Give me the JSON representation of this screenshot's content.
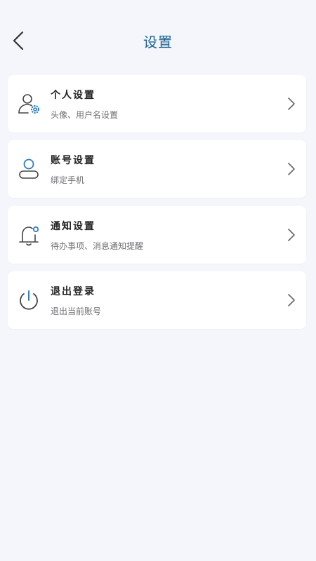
{
  "header": {
    "title": "设置",
    "back_icon": "chevron-left-icon"
  },
  "colors": {
    "title": "#1f6391",
    "accent": "#2f7fb8",
    "icon_stroke": "#444444",
    "background": "#f5f6fb"
  },
  "items": [
    {
      "title": "个人设置",
      "subtitle": "头像、用户名设置",
      "icon": "user-gear-icon"
    },
    {
      "title": "账号设置",
      "subtitle": "绑定手机",
      "icon": "account-icon"
    },
    {
      "title": "通知设置",
      "subtitle": "待办事项、消息通知提醒",
      "icon": "bell-icon"
    },
    {
      "title": "退出登录",
      "subtitle": "退出当前账号",
      "icon": "power-icon"
    }
  ]
}
